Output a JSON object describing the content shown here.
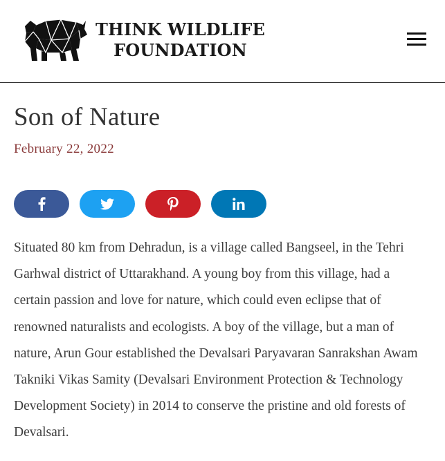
{
  "logo": {
    "line1": "THINK WILDLIFE",
    "line2": "FOUNDATION",
    "icon": "rhino-logo-icon"
  },
  "menu": {
    "icon": "hamburger-menu-icon"
  },
  "post": {
    "title": "Son of Nature",
    "date": "February 22, 2022",
    "body": "Situated 80 km from Dehradun, is a village called Bangseel, in the Tehri Garhwal district of Uttarakhand. A young boy from this village, had a certain passion and love for nature, which could even eclipse that of renowned naturalists and ecologists. A boy of the village, but a man of nature, Arun Gour established the Devalsari Paryavaran Sanrakshan Awam Takniki Vikas Samity (Devalsari Environment Protection & Technology Development Society) in 2014 to conserve the pristine and old forests of Devalsari."
  },
  "share": [
    {
      "network": "Facebook",
      "icon": "facebook-icon",
      "color": "#3b5998"
    },
    {
      "network": "Twitter",
      "icon": "twitter-icon",
      "color": "#1da1f2"
    },
    {
      "network": "Pinterest",
      "icon": "pinterest-icon",
      "color": "#cb2027"
    },
    {
      "network": "LinkedIn",
      "icon": "linkedin-icon",
      "color": "#0077b5"
    }
  ],
  "colors": {
    "date": "#8a3a3a",
    "text": "#3d3d3d",
    "title": "#333333"
  }
}
